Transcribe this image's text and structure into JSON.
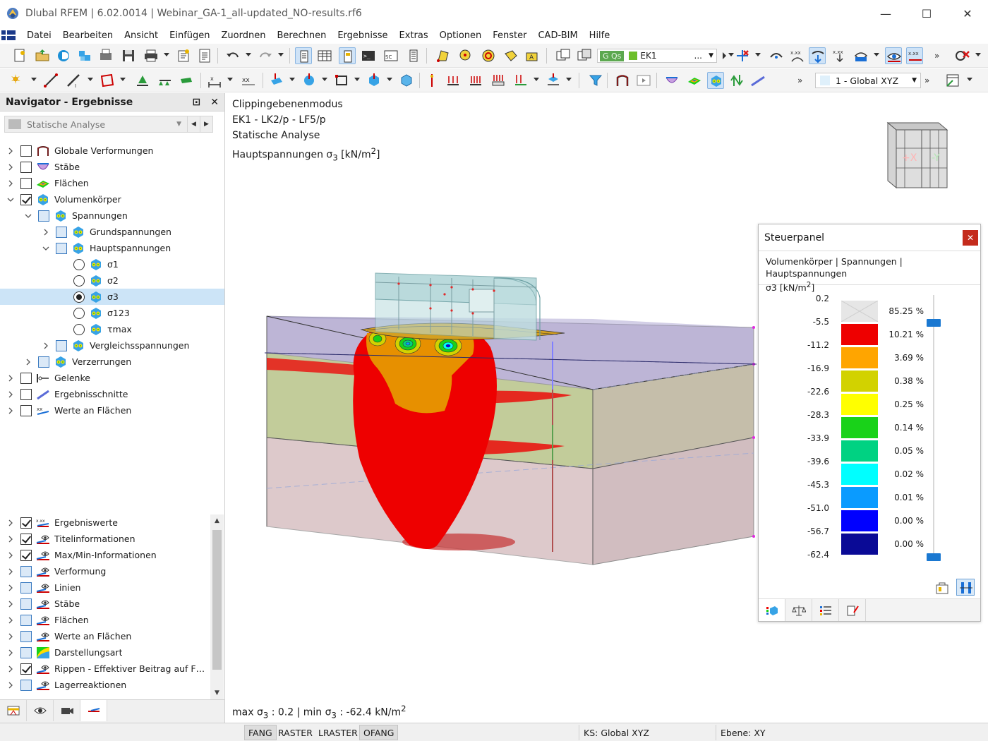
{
  "titlebar": {
    "title": "Dlubal RFEM | 6.02.0014 | Webinar_GA-1_all-updated_NO-results.rf6",
    "minimize": "—",
    "maximize": "☐",
    "close": "✕"
  },
  "menu": [
    "Datei",
    "Bearbeiten",
    "Ansicht",
    "Einfügen",
    "Zuordnen",
    "Berechnen",
    "Ergebnisse",
    "Extras",
    "Optionen",
    "Fenster",
    "CAD-BIM",
    "Hilfe"
  ],
  "toolbar": {
    "load_case_tag": "G Qs",
    "load_case": "EK1",
    "load_case_more": "...",
    "coordinate_system": "1 - Global XYZ",
    "overflow": "»"
  },
  "navigator": {
    "title": "Navigator - Ergebnisse",
    "pin": "⊡",
    "close": "✕",
    "analysis_type": "Statische Analyse",
    "tree_top": [
      {
        "label": "Globale Verformungen",
        "level": 0,
        "expander": "collapsed",
        "control": "checkbox",
        "checked": false,
        "icon": "deformation-icon"
      },
      {
        "label": "Stäbe",
        "level": 0,
        "expander": "collapsed",
        "control": "checkbox",
        "checked": false,
        "icon": "member-icon"
      },
      {
        "label": "Flächen",
        "level": 0,
        "expander": "collapsed",
        "control": "checkbox",
        "checked": false,
        "icon": "surface-icon"
      },
      {
        "label": "Volumenkörper",
        "level": 0,
        "expander": "expanded",
        "control": "checkbox",
        "checked": true,
        "icon": "solid-icon"
      },
      {
        "label": "Spannungen",
        "level": 1,
        "expander": "expanded",
        "control": "checkbox-blue",
        "checked": false,
        "icon": "solid-icon"
      },
      {
        "label": "Grundspannungen",
        "level": 2,
        "expander": "collapsed",
        "control": "checkbox-blue",
        "checked": false,
        "icon": "solid-icon"
      },
      {
        "label": "Hauptspannungen",
        "level": 2,
        "expander": "expanded",
        "control": "checkbox-blue",
        "checked": false,
        "icon": "solid-icon"
      },
      {
        "label": "σ1",
        "level": 3,
        "expander": "none",
        "control": "radio",
        "checked": false,
        "icon": "solid-icon"
      },
      {
        "label": "σ2",
        "level": 3,
        "expander": "none",
        "control": "radio",
        "checked": false,
        "icon": "solid-icon"
      },
      {
        "label": "σ3",
        "level": 3,
        "expander": "none",
        "control": "radio",
        "checked": true,
        "icon": "solid-icon",
        "selected": true
      },
      {
        "label": "σ123",
        "level": 3,
        "expander": "none",
        "control": "radio",
        "checked": false,
        "icon": "solid-icon"
      },
      {
        "label": "τmax",
        "level": 3,
        "expander": "none",
        "control": "radio",
        "checked": false,
        "icon": "solid-icon"
      },
      {
        "label": "Vergleichsspannungen",
        "level": 2,
        "expander": "collapsed",
        "control": "checkbox-blue",
        "checked": false,
        "icon": "solid-icon"
      },
      {
        "label": "Verzerrungen",
        "level": 1,
        "expander": "collapsed",
        "control": "checkbox-blue",
        "checked": false,
        "icon": "solid-icon"
      },
      {
        "label": "Gelenke",
        "level": 0,
        "expander": "collapsed",
        "control": "checkbox",
        "checked": false,
        "icon": "hinge-icon"
      },
      {
        "label": "Ergebnisschnitte",
        "level": 0,
        "expander": "collapsed",
        "control": "checkbox",
        "checked": false,
        "icon": "section-icon"
      },
      {
        "label": "Werte an Flächen",
        "level": 0,
        "expander": "collapsed",
        "control": "checkbox",
        "checked": false,
        "icon": "values-icon"
      }
    ],
    "tree_bottom": [
      {
        "label": "Ergebniswerte",
        "control": "checkbox",
        "checked": true,
        "icon": "result-values-icon"
      },
      {
        "label": "Titelinformationen",
        "control": "checkbox",
        "checked": true,
        "icon": "eye-ruler-icon"
      },
      {
        "label": "Max/Min-Informationen",
        "control": "checkbox",
        "checked": true,
        "icon": "eye-ruler-icon"
      },
      {
        "label": "Verformung",
        "control": "checkbox-blue",
        "checked": false,
        "icon": "eye-ruler-icon"
      },
      {
        "label": "Linien",
        "control": "checkbox-blue",
        "checked": false,
        "icon": "eye-ruler-icon"
      },
      {
        "label": "Stäbe",
        "control": "checkbox-blue",
        "checked": false,
        "icon": "eye-ruler-icon"
      },
      {
        "label": "Flächen",
        "control": "checkbox-blue",
        "checked": false,
        "icon": "eye-ruler-icon"
      },
      {
        "label": "Werte an Flächen",
        "control": "checkbox-blue",
        "checked": false,
        "icon": "eye-ruler-icon"
      },
      {
        "label": "Darstellungsart",
        "control": "checkbox-blue",
        "checked": false,
        "icon": "display-type-icon"
      },
      {
        "label": "Rippen - Effektiver Beitrag auf Fläch...",
        "control": "checkbox",
        "checked": true,
        "icon": "eye-ruler-icon"
      },
      {
        "label": "Lagerreaktionen",
        "control": "checkbox-blue",
        "checked": false,
        "icon": "eye-ruler-icon"
      }
    ]
  },
  "viewport": {
    "mode": "Clippingebenenmodus",
    "load": "EK1 - LK2/p - LF5/p",
    "analysis": "Statische Analyse",
    "result_prefix": "Hauptspannungen σ",
    "result_sub": "3",
    "result_unit": " [kN/m",
    "result_sup": "2",
    "result_close": "]",
    "maxmin_1": "max σ",
    "maxmin_sub1": "3",
    "maxmin_2": " : 0.2 | min σ",
    "maxmin_sub2": "3",
    "maxmin_3": " : -62.4 kN/m",
    "maxmin_sup": "2",
    "cube_x": "+X",
    "cube_y": "-Y"
  },
  "panel": {
    "title": "Steuerpanel",
    "close": "✕",
    "subtitle_1": "Volumenkörper | Spannungen | Hauptspannungen",
    "subtitle_2a": "σ3 [kN/m",
    "subtitle_2sup": "2",
    "subtitle_2b": "]",
    "legend_values": [
      "0.2",
      "-5.5",
      "-11.2",
      "-16.9",
      "-22.6",
      "-28.3",
      "-33.9",
      "-39.6",
      "-45.3",
      "-51.0",
      "-56.7",
      "-62.4"
    ],
    "legend_percents": [
      "85.25 %",
      "10.21 %",
      "3.69 %",
      "0.38 %",
      "0.25 %",
      "0.14 %",
      "0.05 %",
      "0.02 %",
      "0.01 %",
      "0.00 %",
      "0.00 %"
    ],
    "legend_colors": [
      "#e6e6e6",
      "#ee0000",
      "#ffa500",
      "#d2d200",
      "#ffff00",
      "#19d219",
      "#00d282",
      "#00ffff",
      "#0a9bff",
      "#0000ff",
      "#0a0a96"
    ]
  },
  "statusbar": {
    "fang": "FANG",
    "raster": "RASTER",
    "lraster": "LRASTER",
    "ofang": "OFANG",
    "ks": "KS: Global XYZ",
    "ebene": "Ebene: XY"
  }
}
